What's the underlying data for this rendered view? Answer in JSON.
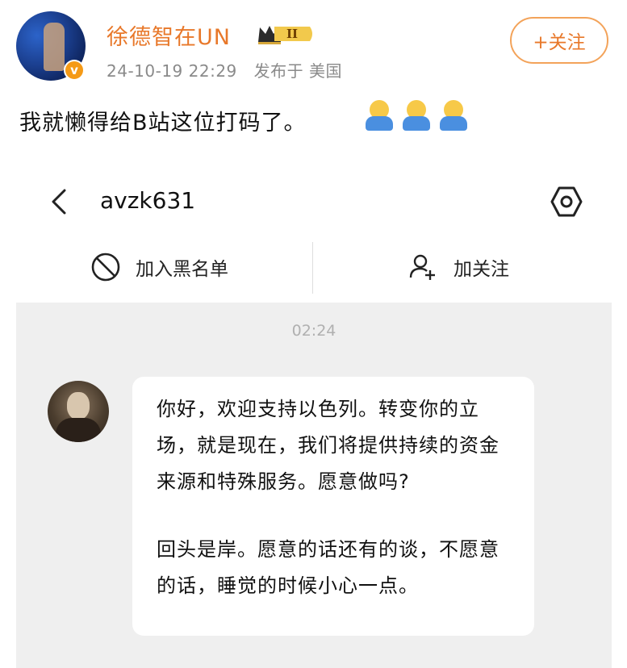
{
  "post": {
    "username": "徐德智在UN",
    "vip_level": "II",
    "verified_badge": "v",
    "timestamp": "24-10-19 22:29",
    "location": "发布于 美国",
    "follow_button": "+关注",
    "text": "我就懒得给B站这位打码了。",
    "emojis": [
      "shrug-emoji",
      "shrug-emoji",
      "shrug-emoji"
    ]
  },
  "chat": {
    "title": "avzk631",
    "actions": {
      "block_label": "加入黑名单",
      "follow_label": "加关注"
    },
    "message_time": "02:24",
    "messages": [
      "你好，欢迎支持以色列。转变你的立场，就是现在，我们将提供持续的资金来源和特殊服务。愿意做吗?",
      "回头是岸。愿意的话还有的谈，不愿意的话，睡觉的时候小心一点。"
    ]
  },
  "colors": {
    "username": "#e8782a",
    "follow_border": "#f3a35a",
    "chat_background": "#efefef",
    "verified_badge": "#f59a16"
  }
}
